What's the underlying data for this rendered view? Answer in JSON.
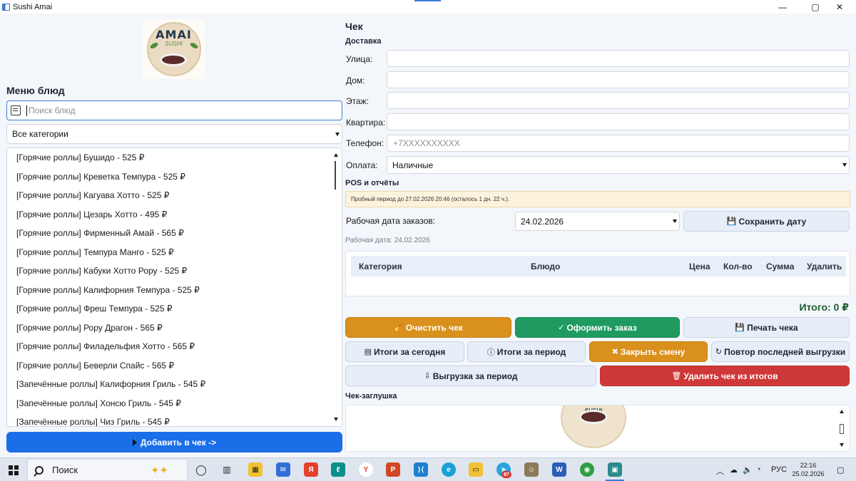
{
  "window": {
    "title": "Sushi Amai",
    "min": "—",
    "max": "▢",
    "close": "✕"
  },
  "logo": {
    "word": "AMAI",
    "sub": "SUSHI"
  },
  "menu": {
    "heading": "Меню блюд",
    "search_placeholder": "Поиск блюд",
    "category_selected": "Все категории",
    "items": [
      "[Горячие роллы] Бушидо - 525 ₽",
      "[Горячие роллы] Креветка Темпура - 525 ₽",
      "[Горячие роллы] Кагуава Хотто - 525 ₽",
      "[Горячие роллы] Цезарь Хотто - 495 ₽",
      "[Горячие роллы] Фирменный Амай - 565 ₽",
      "[Горячие роллы] Темпура Манго - 525 ₽",
      "[Горячие роллы] Кабуки Хотто Рору - 525 ₽",
      "[Горячие роллы] Калифорния Темпура - 525 ₽",
      "[Горячие роллы] Фреш Темпура - 525 ₽",
      "[Горячие роллы] Рору Драгон - 565 ₽",
      "[Горячие роллы] Филадельфия Хотто - 565 ₽",
      "[Горячие роллы] Беверли Спайс - 565 ₽",
      "[Запечённые роллы] Калифорния Гриль - 545 ₽",
      "[Запечённые роллы] Хонсю Гриль - 545 ₽",
      "[Запечённые роллы] Чиз Гриль - 545 ₽"
    ],
    "add_button": "Добавить в чек ->"
  },
  "check": {
    "heading": "Чек",
    "delivery_heading": "Доставка",
    "street_label": "Улица:",
    "house_label": "Дом:",
    "floor_label": "Этаж:",
    "apartment_label": "Квартира:",
    "phone_label": "Телефон:",
    "phone_placeholder": "+7XXXXXXXXXX",
    "payment_label": "Оплата:",
    "payment_selected": "Наличные"
  },
  "pos": {
    "heading": "POS и отчёты",
    "trial_notice": "Пробный период до 27.02.2026 20:46 (осталось 1 дн. 22 ч.).",
    "work_date_label": "Рабочая дата заказов:",
    "work_date_value": "24.02.2026",
    "save_date_button": "Сохранить дату",
    "work_date_info": "Рабочая дата: 24.02.2026"
  },
  "receipt": {
    "columns": [
      "Категория",
      "Блюдо",
      "Цена",
      "Кол-во",
      "Сумма",
      "Удалить"
    ],
    "total": "Итого: 0 ₽"
  },
  "actions": {
    "clear": "Очистить чек",
    "place_order": "Оформить заказ",
    "print": "Печать чека",
    "today_totals": "Итоги за сегодня",
    "period_totals": "Итоги за период",
    "close_shift": "Закрыть смену",
    "repeat_export": "Повтор последней выгрузки",
    "export_period": "Выгрузка за период",
    "delete_from_totals": "Удалить чек из итогов"
  },
  "stub": {
    "heading": "Чек-заглушка",
    "logo_text": "SUSHI"
  },
  "taskbar": {
    "search_label": "Поиск",
    "language": "РУС",
    "time": "22:16",
    "date": "25.02.2026",
    "badge": "87"
  },
  "colors": {
    "primary_blue": "#1a6ee8",
    "orange": "#d9901c",
    "green": "#1f9a60",
    "red": "#cf3838",
    "total_green": "#1d5e33"
  }
}
